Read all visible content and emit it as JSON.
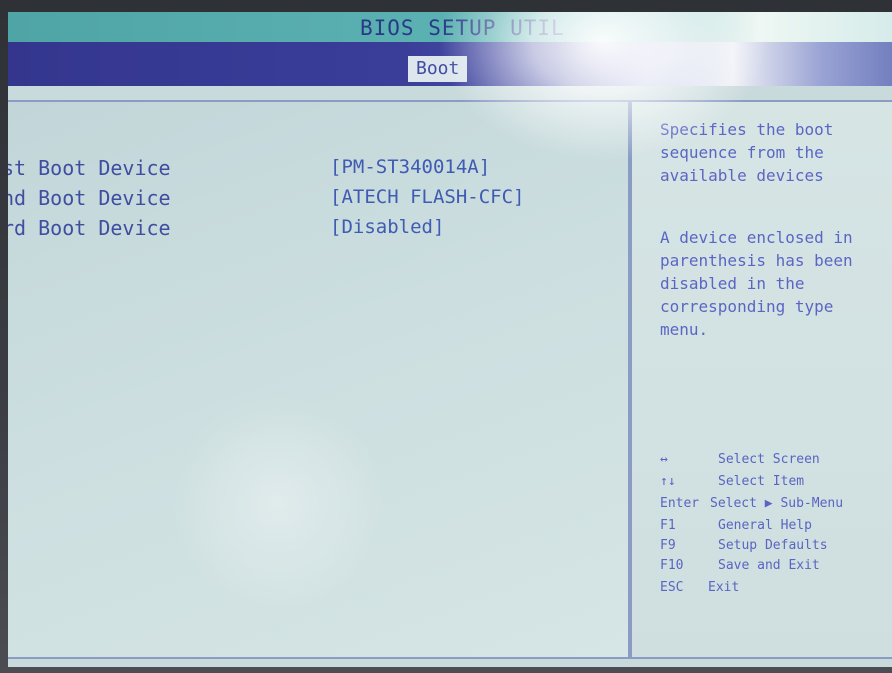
{
  "title": "BIOS SETUP UTIL",
  "menu": {
    "active_tab": "Boot"
  },
  "boot_devices": [
    {
      "label": "st Boot Device",
      "value": "[PM-ST340014A]"
    },
    {
      "label": "nd Boot Device",
      "value": "[ATECH FLASH-CFC]"
    },
    {
      "label": "rd Boot Device",
      "value": "[Disabled]"
    }
  ],
  "help": {
    "description_1": "Specifies the boot sequence from the available devices",
    "description_2": "A device enclosed in parenthesis has been disabled in the corresponding type menu.",
    "keys": [
      {
        "key": "↔",
        "desc": "Select Screen"
      },
      {
        "key": "↑↓",
        "desc": "Select Item"
      },
      {
        "key": "Enter",
        "desc": "Select ▶ Sub-Menu"
      },
      {
        "key": "F1",
        "desc": "General Help"
      },
      {
        "key": "F9",
        "desc": "Setup Defaults"
      },
      {
        "key": "F10",
        "desc": "Save and Exit"
      },
      {
        "key": "ESC",
        "desc": "Exit"
      }
    ]
  },
  "colors": {
    "title_bar": "#5db2b3",
    "menu_bar": "#34368e",
    "panel_bg": "#c9dadc",
    "label_text": "#3f4ea0",
    "help_text": "#5b66c4"
  }
}
